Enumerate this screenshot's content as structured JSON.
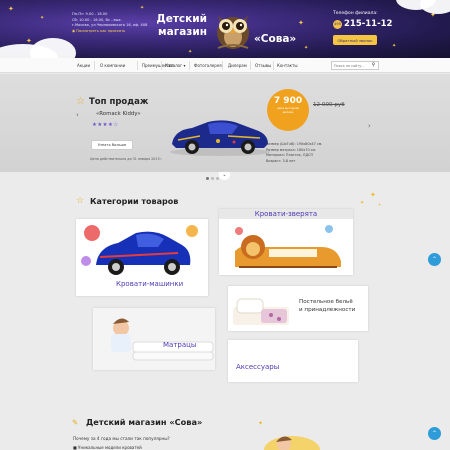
{
  "header": {
    "hours_1": "Пн-Пт: 9.00 - 18.00",
    "hours_2": "Сб: 10.00 - 16.00, Вс - вых.",
    "address": "г.Москва, ул.Черняховского 16, оф. 408",
    "map_link": "Посмотреть как проехать",
    "logo_line_1": "Детский",
    "logo_line_2": "магазин",
    "logo_name": "«Сова»",
    "phone_label": "Телефон филиала:",
    "phone_code": "495",
    "phone": "215-11-12",
    "callback_label": "Обратный звонок"
  },
  "nav": {
    "items": [
      "Акции",
      "О компании",
      "Преимущества",
      "Каталог ▾",
      "Фотогалерея",
      "Дилерам",
      "Отзывы",
      "Контакты"
    ],
    "search_placeholder": "Поиск по сайту..."
  },
  "hero": {
    "title": "Топ продаж",
    "subtitle": "«Romack Kiddy»",
    "rating": 4,
    "rating_max": 5,
    "more_button": "Узнать больше",
    "promo_text": "Цена действительна до 31 января 2017г.",
    "price_new": "7 900",
    "price_note_1": "цена выгоднее",
    "price_note_2": "дилера",
    "price_old": "12 000 руб",
    "specs": [
      "Размер (ШхГхВ): 190х80х47 см.",
      "Размер матраса: 160х70 см.",
      "Материал: Пластик, ЛДСП",
      "Возраст: 3-8 лет"
    ],
    "slides_total": 3,
    "active_slide": 1
  },
  "categories": {
    "title": "Категории товаров",
    "cars": "Кровати-машинки",
    "beasts": "Кровати-зверята",
    "bedding_line_1": "Постельное бельё",
    "bedding_line_2": "и принадлежности",
    "mattresses": "Матрацы",
    "accessories": "Аксессуары"
  },
  "about": {
    "title": "Детский магазин «Сова»",
    "question": "Почему за 4 года мы стали так популярны?",
    "point_1": "■ Уникальные модели кроватей"
  },
  "colors": {
    "accent": "#4f3ab5",
    "gold": "#f0a21f",
    "scroll_button": "#2d9cd8"
  }
}
